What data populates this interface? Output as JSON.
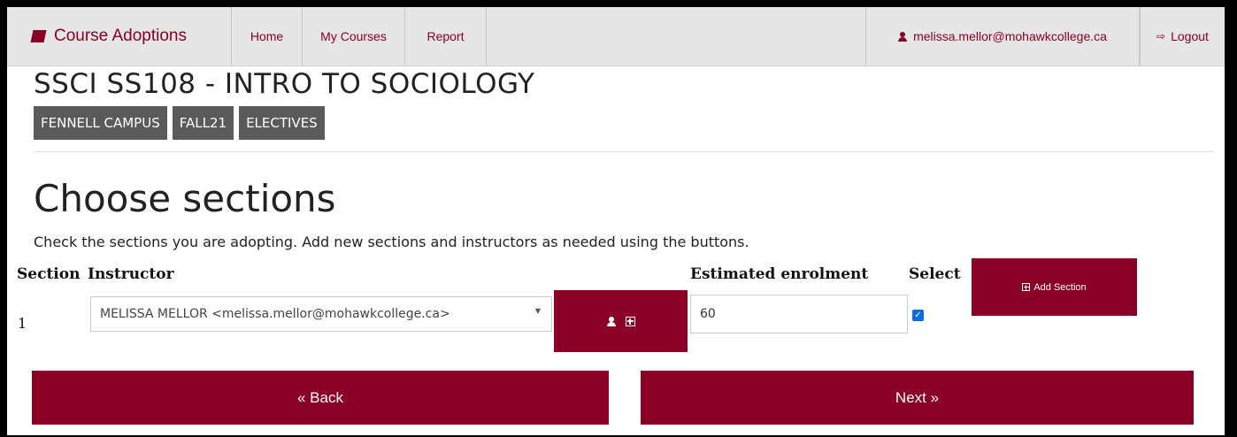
{
  "navbar": {
    "brand": "Course Adoptions",
    "home": "Home",
    "my_courses": "My Courses",
    "report": "Report",
    "user_email": "melissa.mellor@mohawkcollege.ca",
    "logout": "Logout"
  },
  "course": {
    "title": "SSCI SS108 - INTRO TO SOCIOLOGY",
    "tags": [
      "FENNELL CAMPUS",
      "FALL21",
      "ELECTIVES"
    ]
  },
  "page": {
    "heading": "Choose sections",
    "instructions": "Check the sections you are adopting. Add new sections and instructors as needed using the buttons."
  },
  "table": {
    "headers": {
      "section": "Section",
      "instructor": "Instructor",
      "enrolment": "Estimated enrolment",
      "select": "Select"
    },
    "rows": [
      {
        "section": "1",
        "instructor": "MELISSA MELLOR <melissa.mellor@mohawkcollege.ca>",
        "enrolment": "60",
        "selected": true
      }
    ]
  },
  "buttons": {
    "add_section": "Add Section",
    "back": "« Back",
    "next": "Next »"
  },
  "colors": {
    "accent": "#8b0026",
    "tag_bg": "#5a5a5a",
    "checkbox": "#0a6edb"
  }
}
